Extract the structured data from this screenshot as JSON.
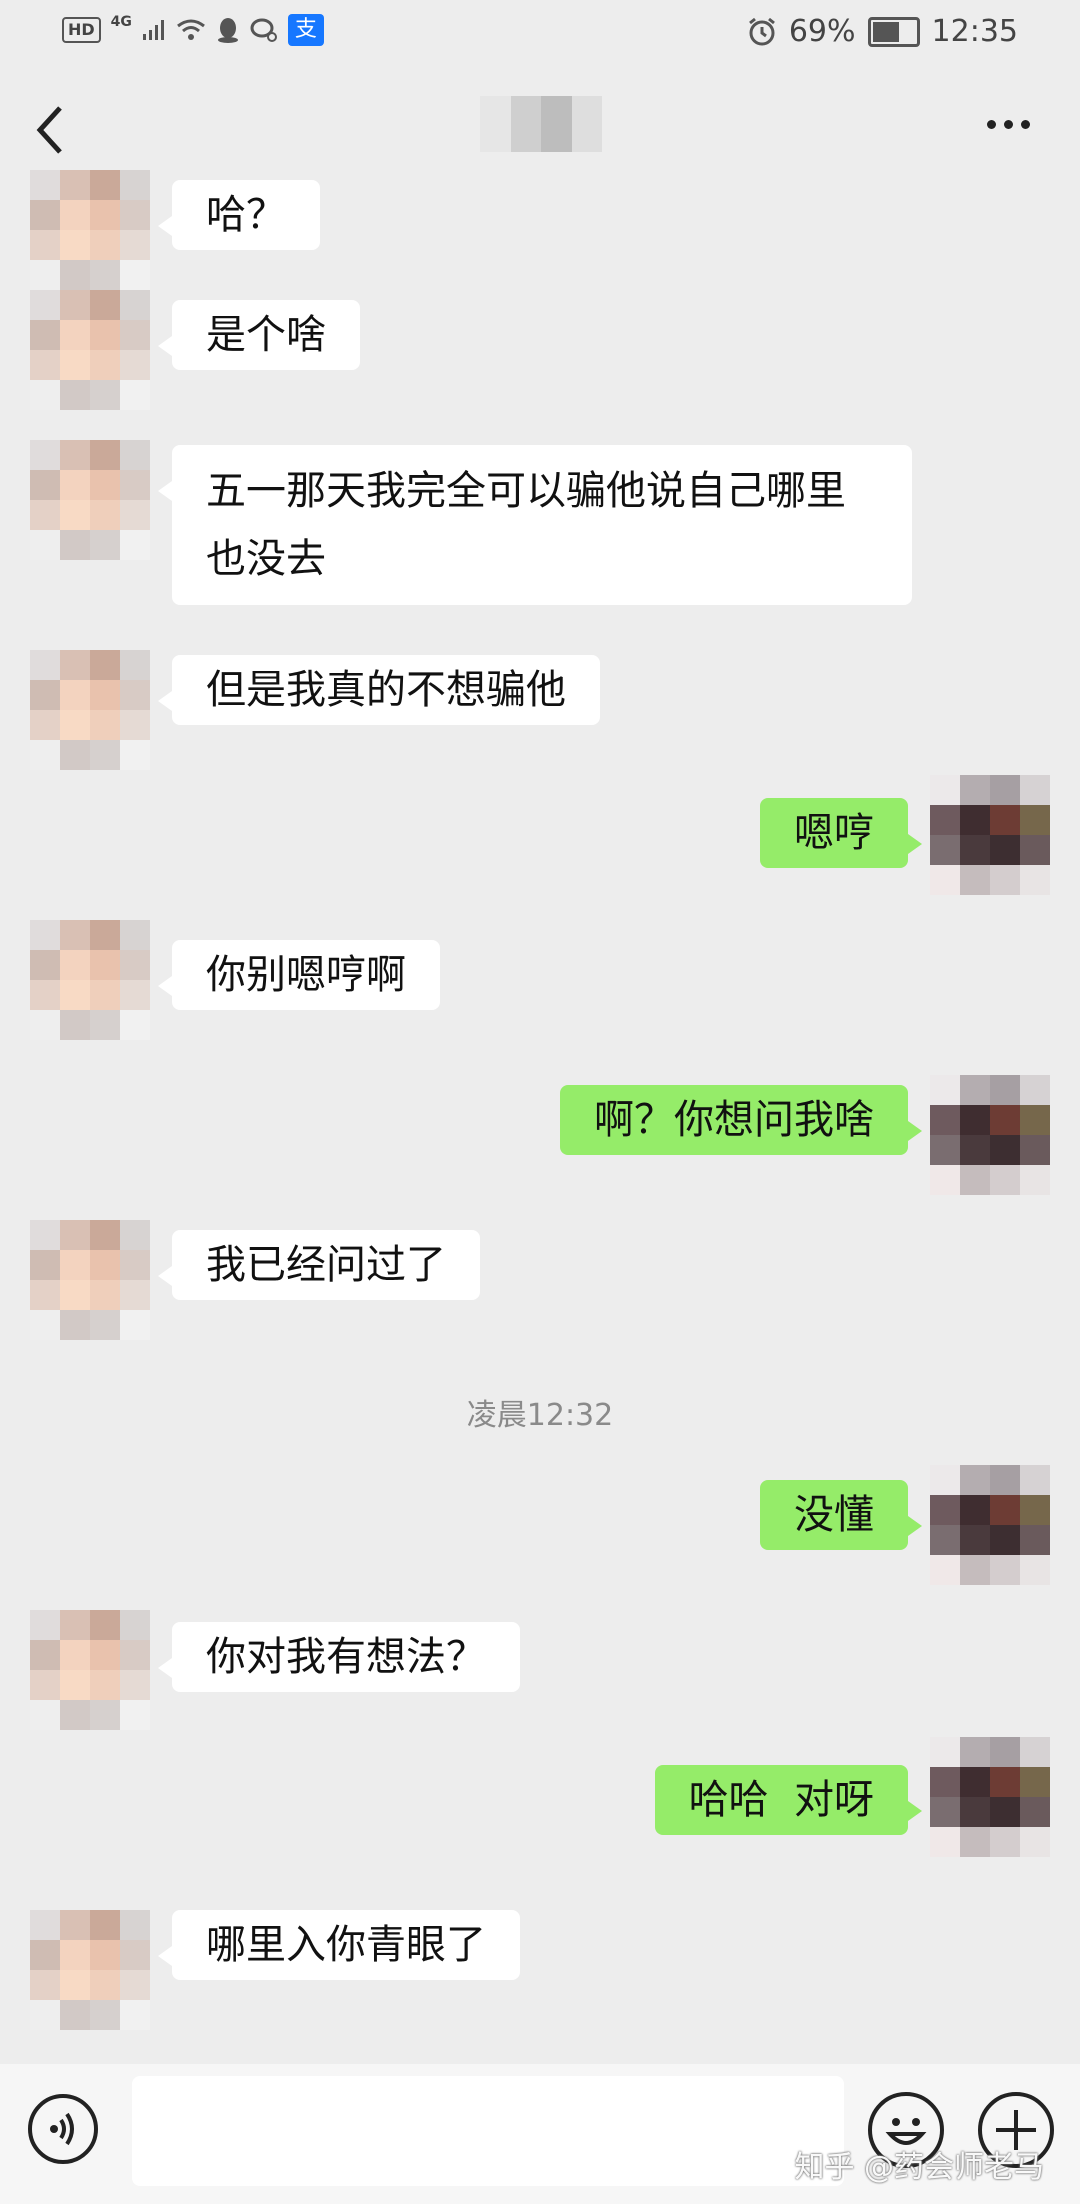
{
  "status_bar": {
    "hd_label": "HD",
    "network_label": "4G",
    "alipay_icon_label": "支",
    "battery_percent": "69%",
    "time": "12:35",
    "battery_level": 0.69
  },
  "nav": {
    "back_icon": "chevron-left-icon",
    "more_icon": "more-dots-icon"
  },
  "messages": [
    {
      "side": "left",
      "text": "哈？"
    },
    {
      "side": "left",
      "text": "是个啥"
    },
    {
      "side": "left",
      "text": "五一那天我完全可以骗他说自己哪里也没去"
    },
    {
      "side": "left",
      "text": "但是我真的不想骗他"
    },
    {
      "side": "right",
      "text": "嗯哼"
    },
    {
      "side": "left",
      "text": "你别嗯哼啊"
    },
    {
      "side": "right",
      "text": "啊？你想问我啥"
    },
    {
      "side": "left",
      "text": "我已经问过了"
    },
    {
      "side": "right",
      "text": "没懂"
    },
    {
      "side": "left",
      "text": "你对我有想法？"
    },
    {
      "side": "right",
      "text": "哈哈  对呀"
    },
    {
      "side": "left",
      "text": "哪里入你青眼了"
    }
  ],
  "timestamp": "凌晨12:32",
  "input_bar": {
    "voice_icon": "voice-icon",
    "emoji_icon": "emoji-icon",
    "plus_icon": "plus-icon",
    "input_value": ""
  },
  "watermark": "知乎 @药会师老马"
}
